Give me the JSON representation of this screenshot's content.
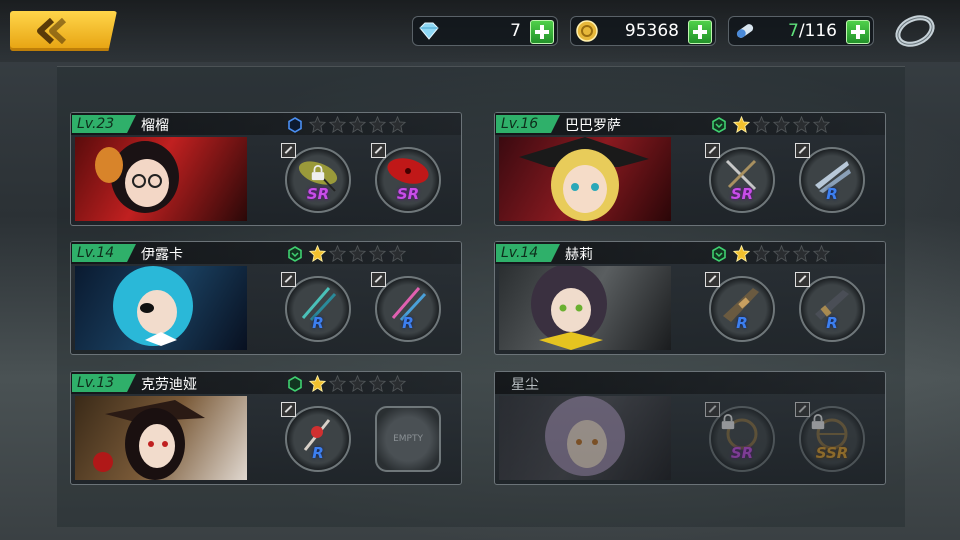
{
  "topbar": {
    "back_icon": "chevron-left-icon",
    "gems": {
      "icon": "diamond-icon",
      "value": "7"
    },
    "coins": {
      "icon": "coin-icon",
      "value": "95368"
    },
    "stamina": {
      "icon": "capsule-icon",
      "value": "7/116",
      "current": "7",
      "max": "/116"
    },
    "settings_icon": "ring-icon"
  },
  "characters": [
    {
      "level": "Lv.23",
      "name": "榴榴",
      "rank": "blue",
      "stars": 0,
      "slots": [
        {
          "rarity": "SR",
          "locked": true,
          "weapon": "umbrella-green"
        },
        {
          "rarity": "SR",
          "locked": false,
          "weapon": "umbrella-red"
        }
      ]
    },
    {
      "level": "Lv.16",
      "name": "巴巴罗萨",
      "rank": "green",
      "stars": 1,
      "slots": [
        {
          "rarity": "SR",
          "locked": false,
          "weapon": "swords"
        },
        {
          "rarity": "R",
          "locked": false,
          "weapon": "blades"
        }
      ]
    },
    {
      "level": "Lv.14",
      "name": "伊露卡",
      "rank": "green",
      "stars": 1,
      "slots": [
        {
          "rarity": "R",
          "locked": false,
          "weapon": "daggers"
        },
        {
          "rarity": "R",
          "locked": false,
          "weapon": "daggers-pink"
        }
      ]
    },
    {
      "level": "Lv.14",
      "name": "赫莉",
      "rank": "green",
      "stars": 1,
      "slots": [
        {
          "rarity": "R",
          "locked": false,
          "weapon": "rifle"
        },
        {
          "rarity": "R",
          "locked": false,
          "weapon": "gun"
        }
      ]
    },
    {
      "level": "Lv.13",
      "name": "克劳迪娅",
      "rank": "green",
      "stars": 1,
      "slots": [
        {
          "rarity": "R",
          "locked": false,
          "weapon": "staff"
        },
        {
          "rarity": "",
          "locked": false,
          "empty": true,
          "empty_label": "EMPTY"
        }
      ]
    },
    {
      "level": "",
      "name": "星尘",
      "rank": "",
      "stars": 0,
      "inactive": true,
      "slots": [
        {
          "rarity": "SR",
          "locked": true,
          "weapon": "wheel"
        },
        {
          "rarity": "SSR",
          "locked": true,
          "weapon": "wheel"
        }
      ]
    }
  ],
  "colors": {
    "accent": "#2fb06a",
    "back_button": "#f2b520",
    "sr": "#c84de8",
    "r": "#3c7ff0",
    "ssr": "#e2a02a"
  }
}
